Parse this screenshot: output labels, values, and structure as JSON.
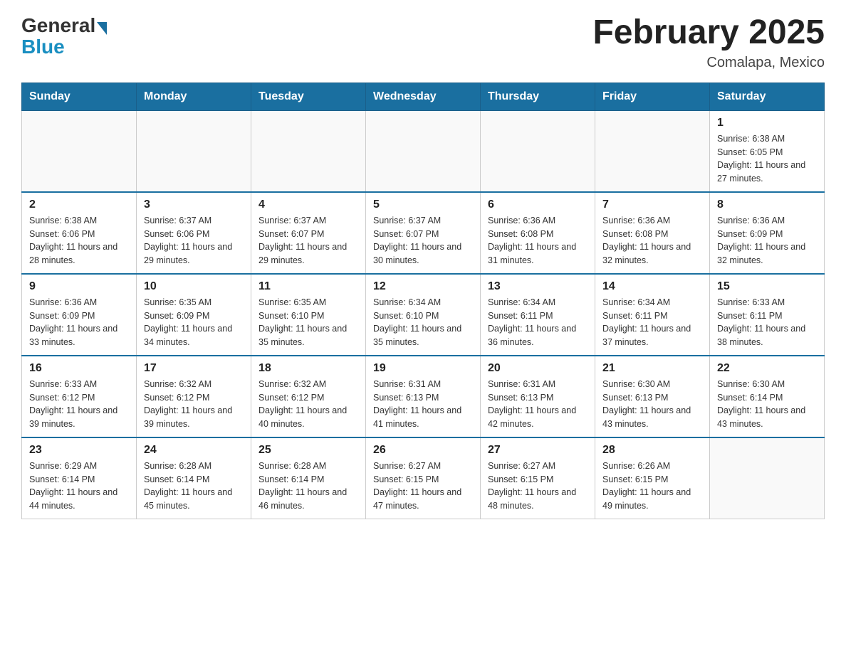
{
  "logo": {
    "general": "General",
    "blue": "Blue"
  },
  "title": "February 2025",
  "location": "Comalapa, Mexico",
  "days_of_week": [
    "Sunday",
    "Monday",
    "Tuesday",
    "Wednesday",
    "Thursday",
    "Friday",
    "Saturday"
  ],
  "weeks": [
    [
      {
        "day": "",
        "info": ""
      },
      {
        "day": "",
        "info": ""
      },
      {
        "day": "",
        "info": ""
      },
      {
        "day": "",
        "info": ""
      },
      {
        "day": "",
        "info": ""
      },
      {
        "day": "",
        "info": ""
      },
      {
        "day": "1",
        "info": "Sunrise: 6:38 AM\nSunset: 6:05 PM\nDaylight: 11 hours and 27 minutes."
      }
    ],
    [
      {
        "day": "2",
        "info": "Sunrise: 6:38 AM\nSunset: 6:06 PM\nDaylight: 11 hours and 28 minutes."
      },
      {
        "day": "3",
        "info": "Sunrise: 6:37 AM\nSunset: 6:06 PM\nDaylight: 11 hours and 29 minutes."
      },
      {
        "day": "4",
        "info": "Sunrise: 6:37 AM\nSunset: 6:07 PM\nDaylight: 11 hours and 29 minutes."
      },
      {
        "day": "5",
        "info": "Sunrise: 6:37 AM\nSunset: 6:07 PM\nDaylight: 11 hours and 30 minutes."
      },
      {
        "day": "6",
        "info": "Sunrise: 6:36 AM\nSunset: 6:08 PM\nDaylight: 11 hours and 31 minutes."
      },
      {
        "day": "7",
        "info": "Sunrise: 6:36 AM\nSunset: 6:08 PM\nDaylight: 11 hours and 32 minutes."
      },
      {
        "day": "8",
        "info": "Sunrise: 6:36 AM\nSunset: 6:09 PM\nDaylight: 11 hours and 32 minutes."
      }
    ],
    [
      {
        "day": "9",
        "info": "Sunrise: 6:36 AM\nSunset: 6:09 PM\nDaylight: 11 hours and 33 minutes."
      },
      {
        "day": "10",
        "info": "Sunrise: 6:35 AM\nSunset: 6:09 PM\nDaylight: 11 hours and 34 minutes."
      },
      {
        "day": "11",
        "info": "Sunrise: 6:35 AM\nSunset: 6:10 PM\nDaylight: 11 hours and 35 minutes."
      },
      {
        "day": "12",
        "info": "Sunrise: 6:34 AM\nSunset: 6:10 PM\nDaylight: 11 hours and 35 minutes."
      },
      {
        "day": "13",
        "info": "Sunrise: 6:34 AM\nSunset: 6:11 PM\nDaylight: 11 hours and 36 minutes."
      },
      {
        "day": "14",
        "info": "Sunrise: 6:34 AM\nSunset: 6:11 PM\nDaylight: 11 hours and 37 minutes."
      },
      {
        "day": "15",
        "info": "Sunrise: 6:33 AM\nSunset: 6:11 PM\nDaylight: 11 hours and 38 minutes."
      }
    ],
    [
      {
        "day": "16",
        "info": "Sunrise: 6:33 AM\nSunset: 6:12 PM\nDaylight: 11 hours and 39 minutes."
      },
      {
        "day": "17",
        "info": "Sunrise: 6:32 AM\nSunset: 6:12 PM\nDaylight: 11 hours and 39 minutes."
      },
      {
        "day": "18",
        "info": "Sunrise: 6:32 AM\nSunset: 6:12 PM\nDaylight: 11 hours and 40 minutes."
      },
      {
        "day": "19",
        "info": "Sunrise: 6:31 AM\nSunset: 6:13 PM\nDaylight: 11 hours and 41 minutes."
      },
      {
        "day": "20",
        "info": "Sunrise: 6:31 AM\nSunset: 6:13 PM\nDaylight: 11 hours and 42 minutes."
      },
      {
        "day": "21",
        "info": "Sunrise: 6:30 AM\nSunset: 6:13 PM\nDaylight: 11 hours and 43 minutes."
      },
      {
        "day": "22",
        "info": "Sunrise: 6:30 AM\nSunset: 6:14 PM\nDaylight: 11 hours and 43 minutes."
      }
    ],
    [
      {
        "day": "23",
        "info": "Sunrise: 6:29 AM\nSunset: 6:14 PM\nDaylight: 11 hours and 44 minutes."
      },
      {
        "day": "24",
        "info": "Sunrise: 6:28 AM\nSunset: 6:14 PM\nDaylight: 11 hours and 45 minutes."
      },
      {
        "day": "25",
        "info": "Sunrise: 6:28 AM\nSunset: 6:14 PM\nDaylight: 11 hours and 46 minutes."
      },
      {
        "day": "26",
        "info": "Sunrise: 6:27 AM\nSunset: 6:15 PM\nDaylight: 11 hours and 47 minutes."
      },
      {
        "day": "27",
        "info": "Sunrise: 6:27 AM\nSunset: 6:15 PM\nDaylight: 11 hours and 48 minutes."
      },
      {
        "day": "28",
        "info": "Sunrise: 6:26 AM\nSunset: 6:15 PM\nDaylight: 11 hours and 49 minutes."
      },
      {
        "day": "",
        "info": ""
      }
    ]
  ]
}
